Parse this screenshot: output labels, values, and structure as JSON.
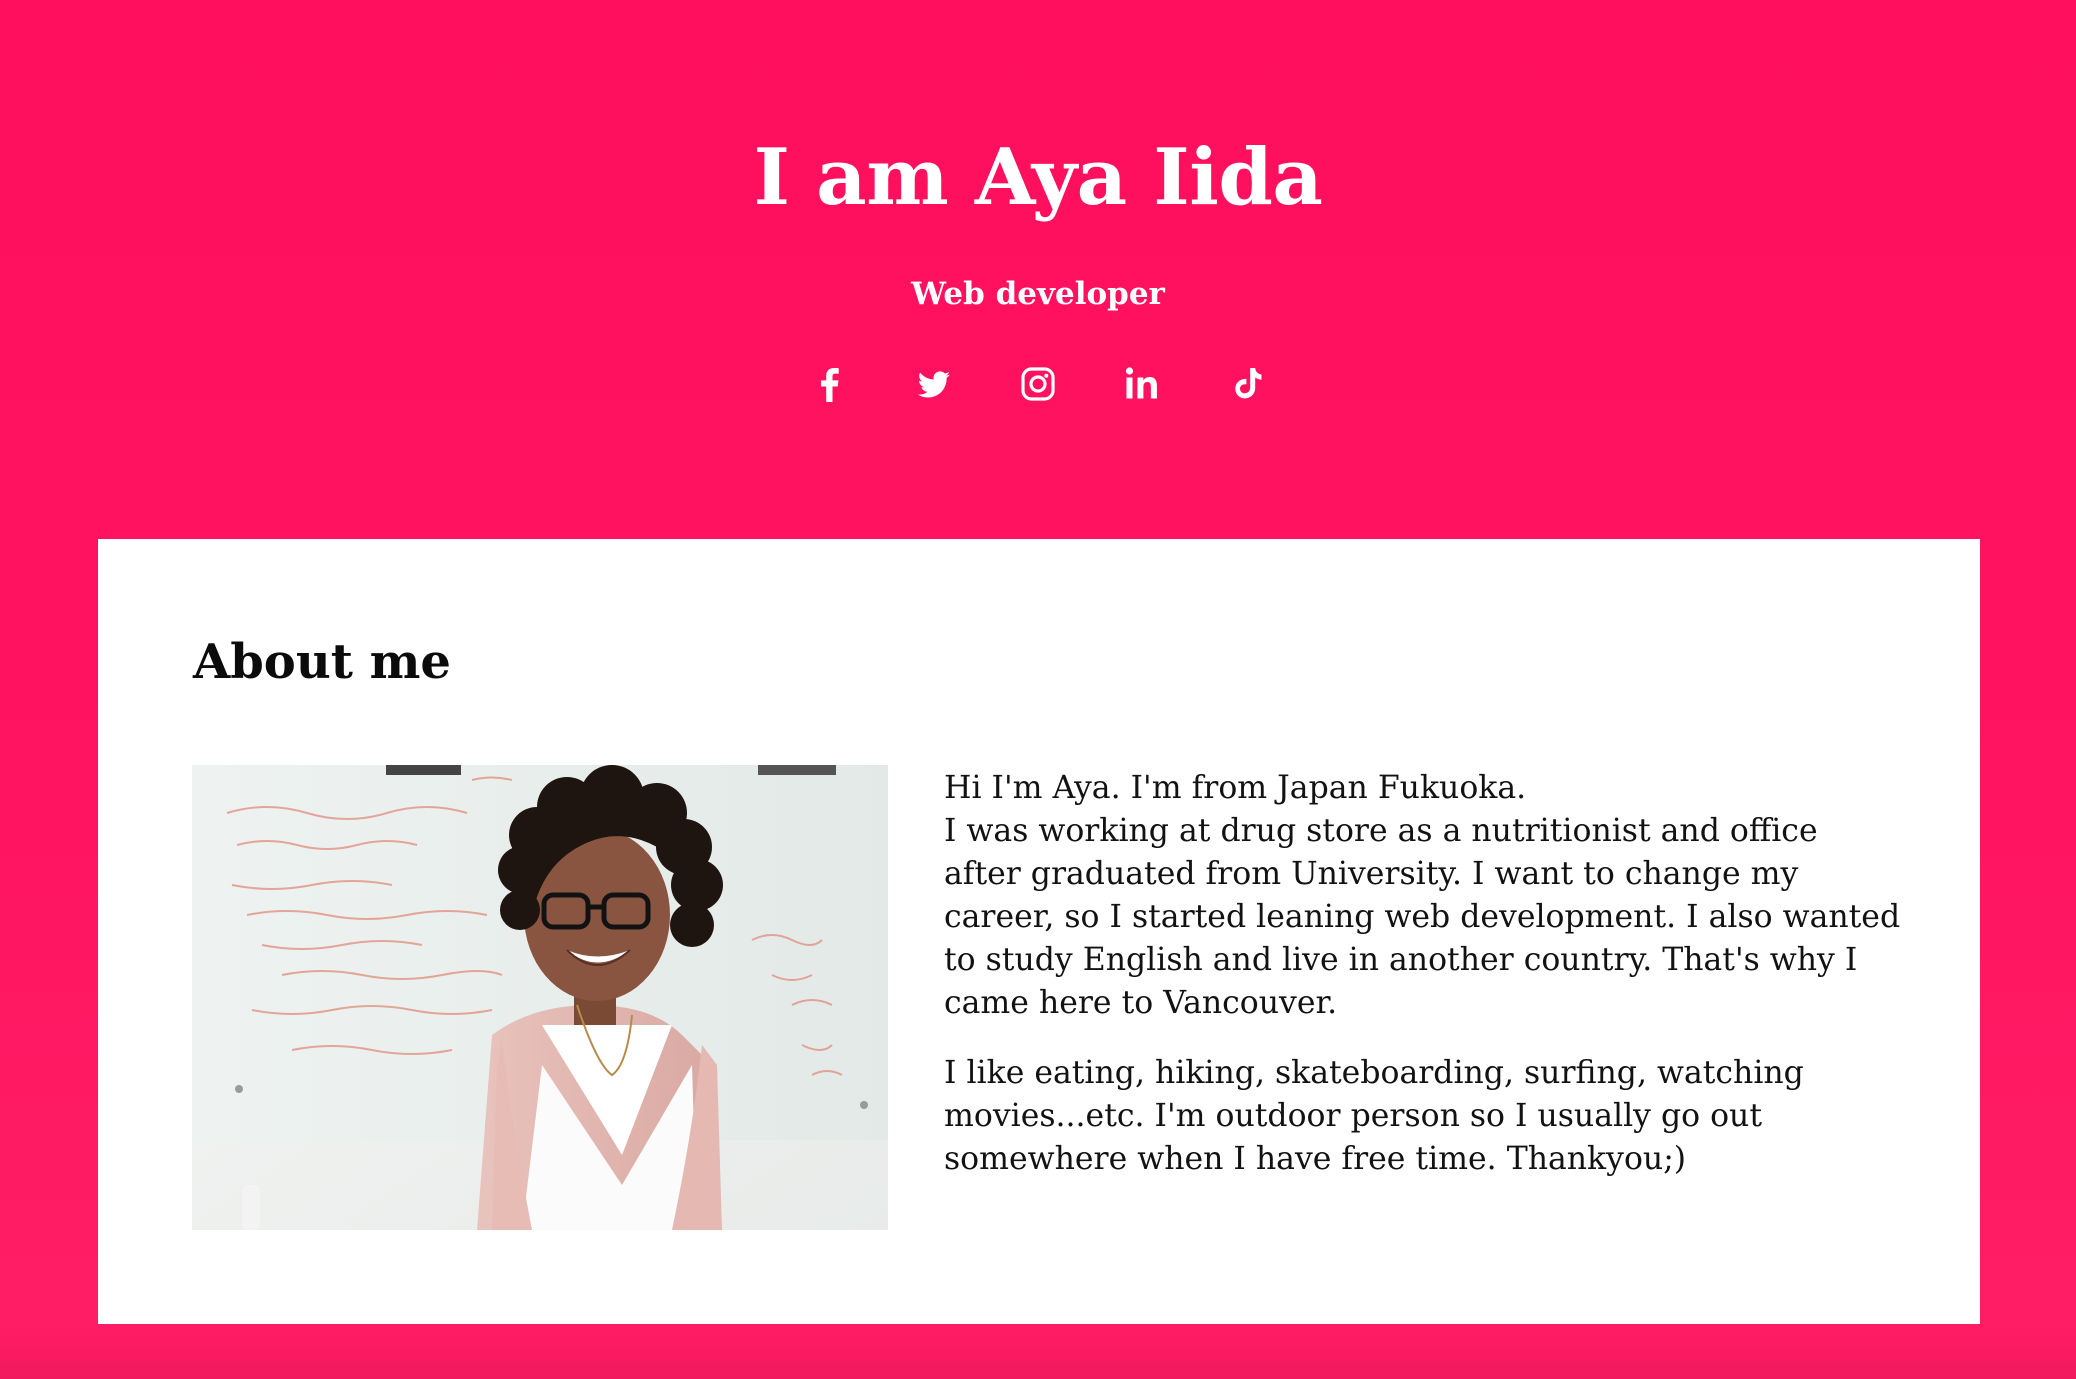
{
  "hero": {
    "title": "I am Aya Iida",
    "subtitle": "Web developer",
    "social": [
      {
        "icon": "facebook-icon"
      },
      {
        "icon": "twitter-icon"
      },
      {
        "icon": "instagram-icon"
      },
      {
        "icon": "linkedin-icon"
      },
      {
        "icon": "tiktok-icon"
      }
    ]
  },
  "about": {
    "title": "About me",
    "paragraph1_line1": "Hi I'm Aya. I'm from Japan Fukuoka.",
    "paragraph1_line2": "I was working at drug store as a nutritionist and office after graduated from University. I want to change my career, so I started leaning web development. I also wanted to study English and live in another country. That's why I came here to Vancouver.",
    "paragraph2": "I like eating, hiking, skateboarding, surfing, watching movies...etc. I'm outdoor person so I usually go out somewhere when I have free time. Thankyou;)"
  },
  "colors": {
    "accent": "#ff1461",
    "card": "#ffffff",
    "text": "#121212"
  }
}
